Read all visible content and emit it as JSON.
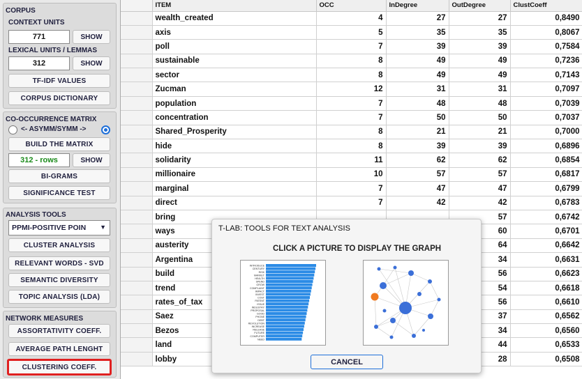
{
  "left_panel": {
    "corpus": {
      "title": "CORPUS",
      "context_units_label": "CONTEXT UNITS",
      "context_units_value": "771",
      "lexical_units_label": "LEXICAL UNITS / LEMMAS",
      "lexical_units_value": "312",
      "show_label": "SHOW",
      "tfidf_label": "TF-IDF VALUES",
      "dictionary_label": "CORPUS DICTIONARY"
    },
    "cooccurrence": {
      "title": "CO-OCCURRENCE MATRIX",
      "radio_label": "<- ASYMM/SYMM ->",
      "build_label": "BUILD THE MATRIX",
      "rows_value": "312 - rows",
      "show_label": "SHOW",
      "bigrams_label": "BI-GRAMS",
      "significance_label": "SIGNIFICANCE TEST"
    },
    "analysis": {
      "title": "ANALYSIS TOOLS",
      "select_value": "PPMI-POSITIVE POIN",
      "cluster_label": "CLUSTER ANALYSIS",
      "relevant_label": "RELEVANT WORDS - SVD",
      "semantic_label": "SEMANTIC DIVERSITY",
      "topic_label": "TOPIC ANALYSIS (LDA)"
    },
    "network": {
      "title": "NETWORK MEASURES",
      "assort_label": "ASSORTATIVITY COEFF.",
      "path_label": "AVERAGE PATH LENGHT",
      "clustering_label": "CLUSTERING COEFF."
    }
  },
  "table": {
    "headers": [
      "",
      "ITEM",
      "OCC",
      "InDegree",
      "OutDegree",
      "ClustCoeff"
    ],
    "rows": [
      {
        "item": "wealth_created",
        "occ": "4",
        "in": "27",
        "out": "27",
        "cc": "0,8490"
      },
      {
        "item": "axis",
        "occ": "5",
        "in": "35",
        "out": "35",
        "cc": "0,8067"
      },
      {
        "item": "poll",
        "occ": "7",
        "in": "39",
        "out": "39",
        "cc": "0,7584"
      },
      {
        "item": "sustainable",
        "occ": "8",
        "in": "49",
        "out": "49",
        "cc": "0,7236"
      },
      {
        "item": "sector",
        "occ": "8",
        "in": "49",
        "out": "49",
        "cc": "0,7143"
      },
      {
        "item": "Zucman",
        "occ": "12",
        "in": "31",
        "out": "31",
        "cc": "0,7097"
      },
      {
        "item": "population",
        "occ": "7",
        "in": "48",
        "out": "48",
        "cc": "0,7039"
      },
      {
        "item": "concentration",
        "occ": "7",
        "in": "50",
        "out": "50",
        "cc": "0,7037"
      },
      {
        "item": "Shared_Prosperity",
        "occ": "8",
        "in": "21",
        "out": "21",
        "cc": "0,7000"
      },
      {
        "item": "hide",
        "occ": "8",
        "in": "39",
        "out": "39",
        "cc": "0,6896"
      },
      {
        "item": "solidarity",
        "occ": "11",
        "in": "62",
        "out": "62",
        "cc": "0,6854"
      },
      {
        "item": "millionaire",
        "occ": "10",
        "in": "57",
        "out": "57",
        "cc": "0,6817"
      },
      {
        "item": "marginal",
        "occ": "7",
        "in": "47",
        "out": "47",
        "cc": "0,6799"
      },
      {
        "item": "direct",
        "occ": "7",
        "in": "42",
        "out": "42",
        "cc": "0,6783"
      },
      {
        "item": "bring",
        "occ": "",
        "in": "",
        "out": "57",
        "cc": "0,6742"
      },
      {
        "item": "ways",
        "occ": "",
        "in": "",
        "out": "60",
        "cc": "0,6701"
      },
      {
        "item": "austerity",
        "occ": "",
        "in": "",
        "out": "64",
        "cc": "0,6642"
      },
      {
        "item": "Argentina",
        "occ": "",
        "in": "",
        "out": "34",
        "cc": "0,6631"
      },
      {
        "item": "build",
        "occ": "",
        "in": "",
        "out": "56",
        "cc": "0,6623"
      },
      {
        "item": "trend",
        "occ": "",
        "in": "",
        "out": "54",
        "cc": "0,6618"
      },
      {
        "item": "rates_of_tax",
        "occ": "",
        "in": "",
        "out": "56",
        "cc": "0,6610"
      },
      {
        "item": "Saez",
        "occ": "",
        "in": "",
        "out": "37",
        "cc": "0,6562"
      },
      {
        "item": "Bezos",
        "occ": "",
        "in": "",
        "out": "34",
        "cc": "0,6560"
      },
      {
        "item": "land",
        "occ": "",
        "in": "",
        "out": "44",
        "cc": "0,6533"
      },
      {
        "item": "lobby",
        "occ": "",
        "in": "",
        "out": "28",
        "cc": "0,6508"
      }
    ]
  },
  "dialog": {
    "title": "T-LAB: TOOLS FOR TEXT ANALYSIS",
    "heading": "CLICK A PICTURE TO DISPLAY THE GRAPH",
    "cancel_label": "CANCEL",
    "bar_thumb_labels": [
      "INTRODUCE",
      "CENTURY",
      "RISK",
      "MARKET",
      "HEALTH",
      "SPEND",
      "GROW",
      "COMPLAINT",
      "IMPACT",
      "INVEST",
      "COST",
      "PATENT",
      "ISSUE",
      "INDUSTRY",
      "PROPOSAL",
      "GOOD",
      "PHONE",
      "DEBT",
      "REVOLUTION",
      "INCREASE",
      "RELEASE",
      "FUTURE",
      "COMPUTER",
      "NEED"
    ],
    "colors": {
      "bar": "#2b8be6",
      "node": "#3b6fd8",
      "node_highlight": "#f07a20",
      "accent": "#1e6fd9",
      "alert": "#e02020"
    }
  }
}
